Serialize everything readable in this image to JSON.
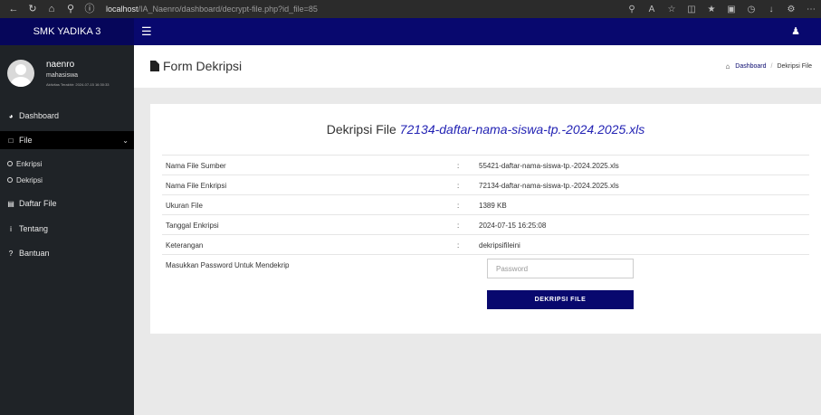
{
  "browser": {
    "url_host": "localhost",
    "url_path": "/IA_Naenro/dashboard/decrypt-file.php?id_file=85"
  },
  "app": {
    "brand": "SMK YADIKA 3"
  },
  "user": {
    "name": "naenro",
    "role": "mahasiswa",
    "last_active": "Aktivitas Terakhir: 2024-07-15 16:30:33"
  },
  "sidebar": {
    "items": [
      {
        "label": "Dashboard",
        "icon": "dashboard-icon"
      },
      {
        "label": "File",
        "icon": "file-icon"
      },
      {
        "label": "Daftar File",
        "icon": "list-icon"
      },
      {
        "label": "Tentang",
        "icon": "info-icon"
      },
      {
        "label": "Bantuan",
        "icon": "question-icon"
      }
    ],
    "sub_items": [
      {
        "label": "Enkripsi"
      },
      {
        "label": "Dekripsi"
      }
    ]
  },
  "header": {
    "title": "Form Dekripsi",
    "breadcrumb": [
      "Dashboard",
      "Dekripsi File"
    ]
  },
  "form": {
    "heading_prefix": "Dekripsi File",
    "heading_file": "72134-daftar-nama-siswa-tp.-2024.2025.xls",
    "rows": [
      {
        "label": "Nama File Sumber",
        "colon": ":",
        "value": "55421-daftar-nama-siswa-tp.-2024.2025.xls"
      },
      {
        "label": "Nama File Enkripsi",
        "colon": ":",
        "value": "72134-daftar-nama-siswa-tp.-2024.2025.xls"
      },
      {
        "label": "Ukuran File",
        "colon": ":",
        "value": "1389 KB"
      },
      {
        "label": "Tanggal Enkripsi",
        "colon": ":",
        "value": "2024-07-15 16:25:08"
      },
      {
        "label": "Keterangan",
        "colon": ":",
        "value": "dekripsifileini"
      }
    ],
    "password_label": "Masukkan Password Untuk Mendekrip",
    "password_placeholder": "Password",
    "submit_label": "DEKRIPSI FILE"
  },
  "colors": {
    "primary": "#08086e",
    "sidebar": "#1f2327",
    "accent_link": "#2323b4"
  }
}
